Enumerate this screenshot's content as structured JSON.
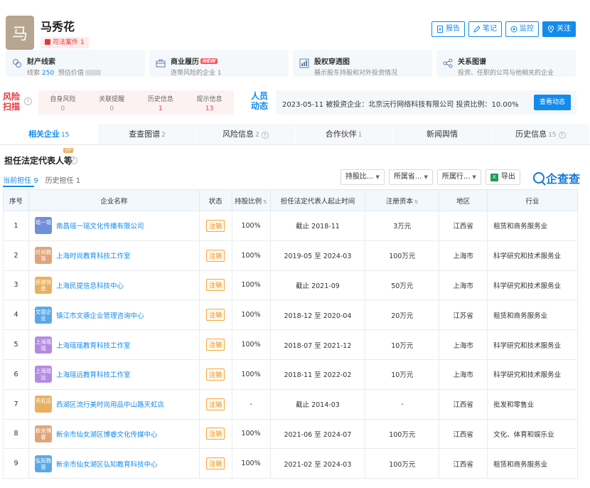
{
  "person": {
    "avatar_char": "马",
    "name": "马秀花",
    "legal_badge": "司法案件 1"
  },
  "actions": [
    {
      "label": "报告",
      "icon": "report-icon"
    },
    {
      "label": "笔记",
      "icon": "pen-icon"
    },
    {
      "label": "监控",
      "icon": "monitor-icon"
    },
    {
      "label": "关注",
      "icon": "location-icon"
    }
  ],
  "cards": [
    {
      "title": "财产线索",
      "sub_prefix": "线索",
      "sub_count": "250",
      "sub_suffix": "预估价值",
      "icon": "coins-icon"
    },
    {
      "title": "商业履历",
      "new_tag": "NEW",
      "sub": "连带风险的企业 1",
      "icon": "briefcase-icon"
    },
    {
      "title": "股权穿透图",
      "sub": "展示股东持股和对外投资情况",
      "icon": "equity-chart-icon"
    },
    {
      "title": "关系图谱",
      "sub": "投资、任职的公司与他相关的企业",
      "icon": "share-graph-icon"
    }
  ],
  "risk": {
    "label": "风险扫描",
    "stats": [
      {
        "label": "自身风险",
        "value": "0"
      },
      {
        "label": "关联提醒",
        "value": "0"
      },
      {
        "label": "历史信息",
        "value": "1"
      },
      {
        "label": "提示信息",
        "value": "13"
      }
    ]
  },
  "dynamics": {
    "label": "人员动态",
    "text": "2023-05-11 被投资企业：北京沅行网络科技有限公司 投资比例：10.00%",
    "button": "查看动态"
  },
  "tabs": [
    {
      "label": "相关企业",
      "count": "15",
      "active": true
    },
    {
      "label": "查查图谱",
      "count": "2"
    },
    {
      "label": "风险信息",
      "count": "2",
      "help": "?"
    },
    {
      "label": "合作伙伴",
      "count": "1"
    },
    {
      "label": "新闻舆情",
      "count": ""
    },
    {
      "label": "历史信息",
      "count": "15",
      "help": "?"
    }
  ],
  "section": {
    "title": "担任法定代表人等",
    "vip": "VIP",
    "subtabs": [
      {
        "label": "当前担任",
        "count": "9"
      },
      {
        "label": "历史担任",
        "count": "1"
      }
    ],
    "filters": [
      "持股比...",
      "所属省...",
      "所属行..."
    ],
    "export": "导出",
    "brand": "企查查"
  },
  "table": {
    "headers": [
      "序号",
      "企业名称",
      "状态",
      "持股比例",
      "担任法定代表人起止时间",
      "注册资本",
      "地区",
      "行业"
    ],
    "rows": [
      {
        "no": "1",
        "logo": "瑶一瑶",
        "logo_color": "#6f8fd6",
        "name": "南昌瑶一瑶文化传播有限公司",
        "status": "注销",
        "share": "100%",
        "period": "截止 2018-11",
        "capital": "3万元",
        "region": "江西省",
        "industry": "租赁和商务服务业"
      },
      {
        "no": "2",
        "logo": "时尚教育",
        "logo_color": "#e0a47a",
        "name": "上海时尚教育科技工作室",
        "status": "注销",
        "share": "100%",
        "period": "2019-05 至 2024-03",
        "capital": "100万元",
        "region": "上海市",
        "industry": "科学研究和技术服务业"
      },
      {
        "no": "3",
        "logo": "民提信息",
        "logo_color": "#e9b15f",
        "name": "上海民提信息科技中心",
        "status": "注销",
        "share": "100%",
        "period": "截止 2021-09",
        "capital": "50万元",
        "region": "上海市",
        "industry": "科学研究和技术服务业"
      },
      {
        "no": "4",
        "logo": "文德企业",
        "logo_color": "#5aa9e6",
        "name": "镇江市文德企业管理咨询中心",
        "status": "注销",
        "share": "100%",
        "period": "2018-12 至 2020-04",
        "capital": "20万元",
        "region": "江苏省",
        "industry": "租赁和商务服务业"
      },
      {
        "no": "5",
        "logo": "上海瑶瑶",
        "logo_color": "#b48be0",
        "name": "上海瑶瑶教育科技工作室",
        "status": "注销",
        "share": "100%",
        "period": "2018-07 至 2021-12",
        "capital": "10万元",
        "region": "上海市",
        "industry": "科学研究和技术服务业"
      },
      {
        "no": "6",
        "logo": "上海瑶远",
        "logo_color": "#b48be0",
        "name": "上海瑶远教育科技工作室",
        "status": "注销",
        "share": "100%",
        "period": "2018-11 至 2022-02",
        "capital": "10万元",
        "region": "上海市",
        "industry": "科学研究和技术服务业"
      },
      {
        "no": "7",
        "logo": "天虹店",
        "logo_color": "#e9b15f",
        "name": "西湖区流行美时尚用品中山路天虹店",
        "status": "注销",
        "share": "-",
        "period": "截止 2014-03",
        "capital": "-",
        "region": "江西省",
        "industry": "批发和零售业"
      },
      {
        "no": "8",
        "logo": "新余博睿",
        "logo_color": "#e0a47a",
        "name": "新余市仙女湖区博睿文化传媒中心",
        "status": "注销",
        "share": "100%",
        "period": "2021-06 至 2024-07",
        "capital": "100万元",
        "region": "江西省",
        "industry": "文化、体育和娱乐业"
      },
      {
        "no": "9",
        "logo": "弘知教育",
        "logo_color": "#5aa9e6",
        "name": "新余市仙女湖区弘知教育科技中心",
        "status": "注销",
        "share": "100%",
        "period": "2021-02 至 2024-03",
        "capital": "100万元",
        "region": "江西省",
        "industry": "租赁和商务服务业"
      }
    ]
  }
}
